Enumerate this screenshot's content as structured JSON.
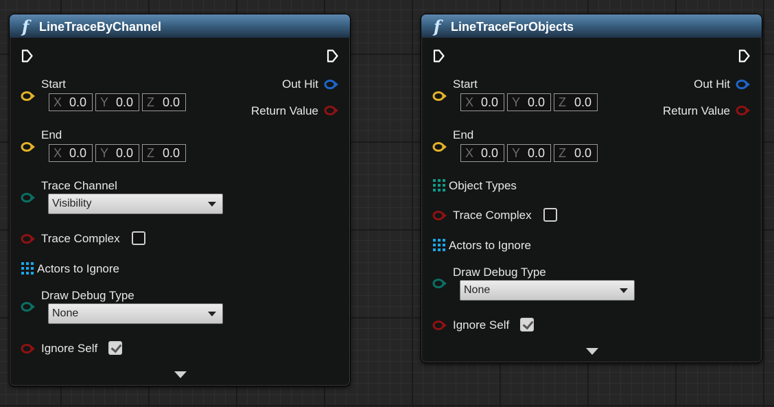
{
  "nodes": [
    {
      "title": "LineTraceByChannel",
      "icon": "f",
      "start_label": "Start",
      "start": {
        "x_axis": "X",
        "x": "0.0",
        "y_axis": "Y",
        "y": "0.0",
        "z_axis": "Z",
        "z": "0.0"
      },
      "end_label": "End",
      "end": {
        "x_axis": "X",
        "x": "0.0",
        "y_axis": "Y",
        "y": "0.0",
        "z_axis": "Z",
        "z": "0.0"
      },
      "trace_channel_label": "Trace Channel",
      "trace_channel_value": "Visibility",
      "trace_complex_label": "Trace Complex",
      "trace_complex_checked": false,
      "actors_to_ignore_label": "Actors to Ignore",
      "draw_debug_label": "Draw Debug Type",
      "draw_debug_value": "None",
      "ignore_self_label": "Ignore Self",
      "ignore_self_checked": true,
      "out_hit_label": "Out Hit",
      "return_value_label": "Return Value"
    },
    {
      "title": "LineTraceForObjects",
      "icon": "f",
      "start_label": "Start",
      "start": {
        "x_axis": "X",
        "x": "0.0",
        "y_axis": "Y",
        "y": "0.0",
        "z_axis": "Z",
        "z": "0.0"
      },
      "end_label": "End",
      "end": {
        "x_axis": "X",
        "x": "0.0",
        "y_axis": "Y",
        "y": "0.0",
        "z_axis": "Z",
        "z": "0.0"
      },
      "object_types_label": "Object Types",
      "trace_complex_label": "Trace Complex",
      "trace_complex_checked": false,
      "actors_to_ignore_label": "Actors to Ignore",
      "draw_debug_label": "Draw Debug Type",
      "draw_debug_value": "None",
      "ignore_self_label": "Ignore Self",
      "ignore_self_checked": true,
      "out_hit_label": "Out Hit",
      "return_value_label": "Return Value"
    }
  ],
  "colors": {
    "vector_pin": "#e2b22a",
    "struct_pin": "#1d66c8",
    "bool_pin": "#8e1212",
    "byte_pin": "#0a6f62",
    "array_pin": "#1aa7e6",
    "header": "#3d6688"
  }
}
